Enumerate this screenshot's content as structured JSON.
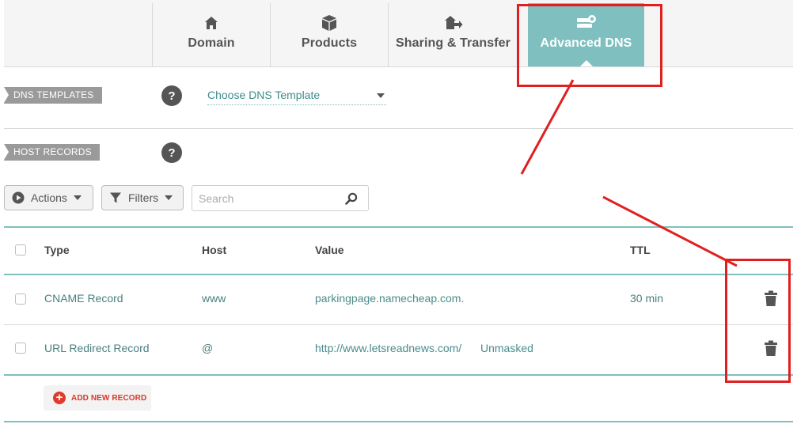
{
  "tabs": [
    {
      "label": "Domain",
      "icon": "home-icon",
      "active": false
    },
    {
      "label": "Products",
      "icon": "box-icon",
      "active": false
    },
    {
      "label": "Sharing & Transfer",
      "icon": "house-transfer-icon",
      "active": false
    },
    {
      "label": "Advanced DNS",
      "icon": "dns-server-icon",
      "active": true
    }
  ],
  "dns_templates": {
    "section_label": "DNS TEMPLATES",
    "help": "?",
    "select_value": "Choose DNS Template"
  },
  "host_records": {
    "section_label": "HOST RECORDS",
    "help": "?"
  },
  "toolbar": {
    "actions_label": "Actions",
    "filters_label": "Filters",
    "search_placeholder": "Search"
  },
  "table": {
    "headers": {
      "type": "Type",
      "host": "Host",
      "value": "Value",
      "ttl": "TTL"
    },
    "rows": [
      {
        "type": "CNAME Record",
        "host": "www",
        "value": "parkingpage.namecheap.com.",
        "extra": "",
        "ttl": "30 min"
      },
      {
        "type": "URL Redirect Record",
        "host": "@",
        "value": "http://www.letsreadnews.com/",
        "extra": "Unmasked",
        "ttl": ""
      }
    ]
  },
  "add_record": {
    "label": "ADD NEW RECORD"
  },
  "colors": {
    "accent": "#7fbfbf",
    "annotation": "#e02020",
    "add": "#e03a2c"
  }
}
